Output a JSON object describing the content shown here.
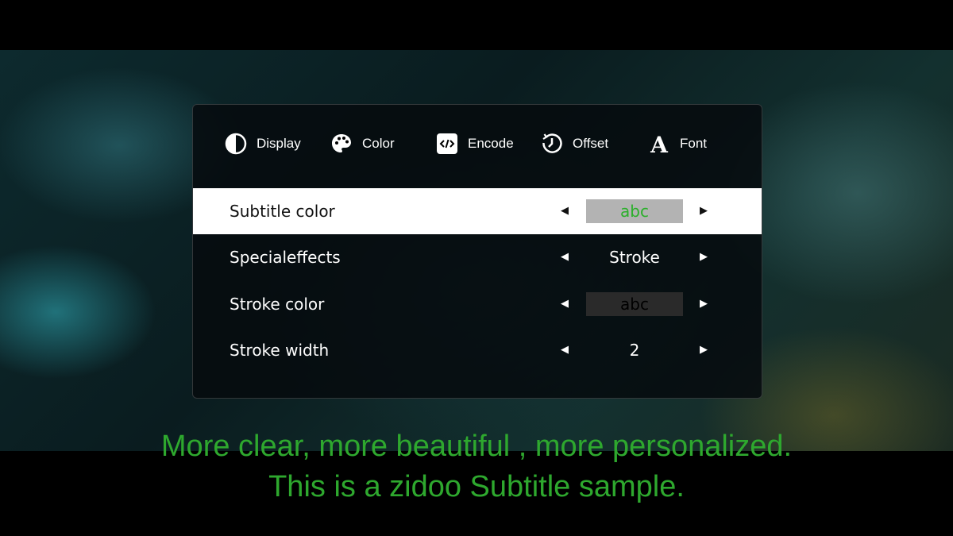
{
  "tabs": [
    {
      "label": "Display",
      "icon": "display-contrast-icon"
    },
    {
      "label": "Color",
      "icon": "palette-icon"
    },
    {
      "label": "Encode",
      "icon": "code-icon"
    },
    {
      "label": "Offset",
      "icon": "clock-offset-icon"
    },
    {
      "label": "Font",
      "icon": "font-icon"
    }
  ],
  "rows": [
    {
      "label": "Subtitle color",
      "value": "abc",
      "selected": true
    },
    {
      "label": "Specialeffects",
      "value": "Stroke",
      "selected": false
    },
    {
      "label": "Stroke color",
      "value": "abc",
      "selected": false
    },
    {
      "label": "Stroke width",
      "value": "2",
      "selected": false
    }
  ],
  "arrows": {
    "left": "◀",
    "right": "▶"
  },
  "subtitles": {
    "line1": "More clear, more beautiful , more personalized.",
    "line2": "This is a zidoo Subtitle sample."
  },
  "colors": {
    "subtitle_text": "#2ea82e",
    "swatch_green_text": "#2bb02b",
    "selected_row_bg": "#ffffff"
  }
}
